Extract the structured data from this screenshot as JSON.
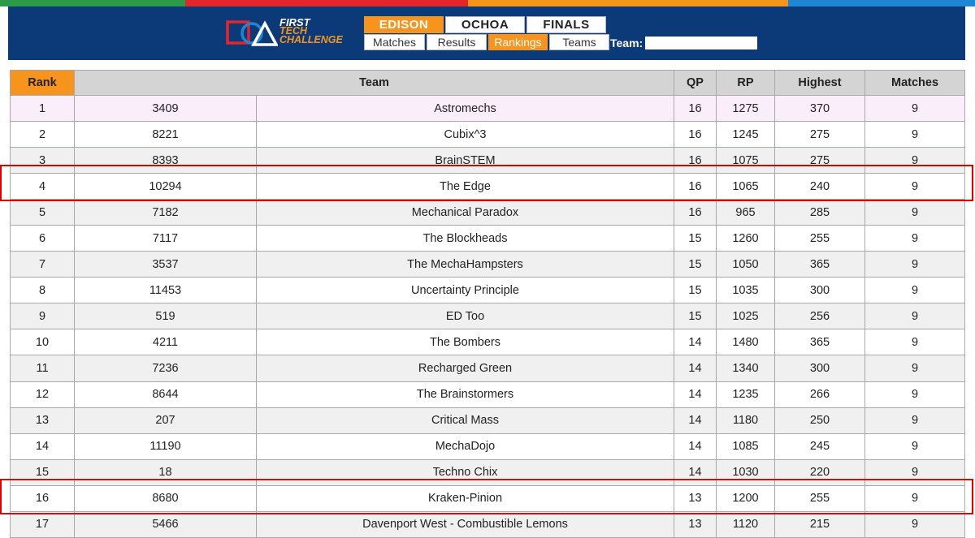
{
  "header": {
    "logo": {
      "line1": "FIRST",
      "line2": "TECH",
      "line3": "CHALLENGE"
    },
    "divisions": [
      {
        "label": "EDISON",
        "active": true
      },
      {
        "label": "OCHOA",
        "active": false
      },
      {
        "label": "FINALS",
        "active": false
      }
    ],
    "nav": [
      {
        "label": "Matches",
        "active": false
      },
      {
        "label": "Results",
        "active": false
      },
      {
        "label": "Rankings",
        "active": true
      },
      {
        "label": "Teams",
        "active": false
      }
    ],
    "team_search": {
      "label": "Team:",
      "value": ""
    }
  },
  "colors": {
    "header_bg": "#0c3a78",
    "accent_orange": "#f7941d",
    "highlight_red": "#e00000"
  },
  "table": {
    "columns": [
      "Rank",
      "Team",
      "QP",
      "RP",
      "Highest",
      "Matches"
    ],
    "rows": [
      {
        "rank": "1",
        "number": "3409",
        "name": "Astromechs",
        "qp": "16",
        "rp": "1275",
        "highest": "370",
        "matches": "9"
      },
      {
        "rank": "2",
        "number": "8221",
        "name": "Cubix^3",
        "qp": "16",
        "rp": "1245",
        "highest": "275",
        "matches": "9"
      },
      {
        "rank": "3",
        "number": "8393",
        "name": "BrainSTEM",
        "qp": "16",
        "rp": "1075",
        "highest": "275",
        "matches": "9"
      },
      {
        "rank": "4",
        "number": "10294",
        "name": "The Edge",
        "qp": "16",
        "rp": "1065",
        "highest": "240",
        "matches": "9"
      },
      {
        "rank": "5",
        "number": "7182",
        "name": "Mechanical Paradox",
        "qp": "16",
        "rp": "965",
        "highest": "285",
        "matches": "9"
      },
      {
        "rank": "6",
        "number": "7117",
        "name": "The Blockheads",
        "qp": "15",
        "rp": "1260",
        "highest": "255",
        "matches": "9"
      },
      {
        "rank": "7",
        "number": "3537",
        "name": "The MechaHampsters",
        "qp": "15",
        "rp": "1050",
        "highest": "365",
        "matches": "9"
      },
      {
        "rank": "8",
        "number": "11453",
        "name": "Uncertainty Principle",
        "qp": "15",
        "rp": "1035",
        "highest": "300",
        "matches": "9"
      },
      {
        "rank": "9",
        "number": "519",
        "name": "ED Too",
        "qp": "15",
        "rp": "1025",
        "highest": "256",
        "matches": "9"
      },
      {
        "rank": "10",
        "number": "4211",
        "name": "The Bombers",
        "qp": "14",
        "rp": "1480",
        "highest": "365",
        "matches": "9"
      },
      {
        "rank": "11",
        "number": "7236",
        "name": "Recharged Green",
        "qp": "14",
        "rp": "1340",
        "highest": "300",
        "matches": "9"
      },
      {
        "rank": "12",
        "number": "8644",
        "name": "The Brainstormers",
        "qp": "14",
        "rp": "1235",
        "highest": "266",
        "matches": "9"
      },
      {
        "rank": "13",
        "number": "207",
        "name": "Critical Mass",
        "qp": "14",
        "rp": "1180",
        "highest": "250",
        "matches": "9"
      },
      {
        "rank": "14",
        "number": "11190",
        "name": "MechaDojo",
        "qp": "14",
        "rp": "1085",
        "highest": "245",
        "matches": "9"
      },
      {
        "rank": "15",
        "number": "18",
        "name": "Techno Chix",
        "qp": "14",
        "rp": "1030",
        "highest": "220",
        "matches": "9"
      },
      {
        "rank": "16",
        "number": "8680",
        "name": "Kraken-Pinion",
        "qp": "13",
        "rp": "1200",
        "highest": "255",
        "matches": "9"
      },
      {
        "rank": "17",
        "number": "5466",
        "name": "Davenport West - Combustible Lemons",
        "qp": "13",
        "rp": "1120",
        "highest": "215",
        "matches": "9"
      }
    ]
  }
}
